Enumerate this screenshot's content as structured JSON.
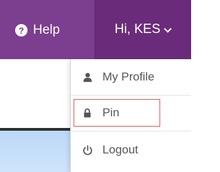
{
  "topbar": {
    "help_label": "Help",
    "help_icon": "question-circle-icon",
    "greeting": "Hi, KES",
    "chevron_icon": "chevron-down-icon"
  },
  "dropdown": {
    "items": [
      {
        "label": "My Profile",
        "icon": "user-icon"
      },
      {
        "label": "Pin",
        "icon": "lock-icon",
        "highlighted": true
      },
      {
        "label": "Logout",
        "icon": "power-icon"
      }
    ]
  },
  "colors": {
    "topbar": "#7c3e8e",
    "topbar_active": "#6a2c7a",
    "highlight_border": "#e05a5a",
    "menu_text": "#555555"
  }
}
